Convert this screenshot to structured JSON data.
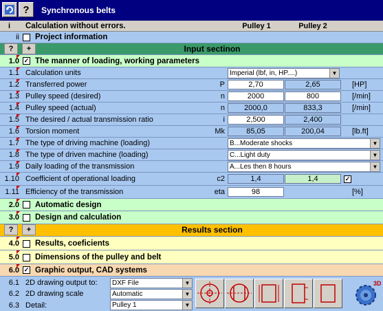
{
  "window": {
    "title": "Synchronous belts",
    "app_icon": "refresh-icon",
    "help_label": "?"
  },
  "header": {
    "i": "i",
    "status": "Calculation without errors.",
    "pulley1": "Pulley 1",
    "pulley2": "Pulley 2"
  },
  "project": {
    "idx": "ii",
    "label": "Project information"
  },
  "input_bar": {
    "q": "?",
    "plus": "+",
    "label": "Input sectinon"
  },
  "sections": {
    "s1": {
      "idx": "1.0",
      "label": "The manner of loading, working parameters",
      "checked": "✓"
    },
    "s2": {
      "idx": "2.0",
      "label": "Automatic design"
    },
    "s3": {
      "idx": "3.0",
      "label": "Design and calculation"
    },
    "s4": {
      "idx": "4.0",
      "label": "Results, coeficients"
    },
    "s5": {
      "idx": "5.0",
      "label": "Dimensions of the pulley and belt"
    },
    "s6": {
      "idx": "6.0",
      "label": "Graphic output, CAD systems",
      "checked": "✓"
    }
  },
  "results_bar": {
    "q": "?",
    "plus": "+",
    "label": "Results section"
  },
  "params": {
    "r1": {
      "idx": "1.1",
      "label": "Calculation units",
      "value": "Imperial (lbf, in, HP....)"
    },
    "r2": {
      "idx": "1.2",
      "label": "Transferred power",
      "sym": "P",
      "v1": "2,70",
      "v2": "2,65",
      "unit": "[HP]"
    },
    "r3": {
      "idx": "1.3",
      "label": "Pulley speed (desired)",
      "sym": "n",
      "v1": "2000",
      "v2": "800",
      "unit": "[/min]"
    },
    "r4": {
      "idx": "1.4",
      "label": "Pulley speed (actual)",
      "sym": "n",
      "v1": "2000,0",
      "v2": "833,3",
      "unit": "[/min]"
    },
    "r5": {
      "idx": "1.5",
      "label": "The desired / actual transmission ratio",
      "sym": "i",
      "v1": "2,500",
      "v2": "2,400"
    },
    "r6": {
      "idx": "1.6",
      "label": "Torsion moment",
      "sym": "Mk",
      "v1": "85,05",
      "v2": "200,04",
      "unit": "[lb.ft]"
    },
    "r7": {
      "idx": "1.7",
      "label": "The type of driving machine (loading)",
      "value": "B...Moderate shocks"
    },
    "r8": {
      "idx": "1.8",
      "label": "The type of driven machine (loading)",
      "value": "C...Light duty"
    },
    "r9": {
      "idx": "1.9",
      "label": "Daily loading of the transmission",
      "value": "A...Les then 8 hours"
    },
    "r10": {
      "idx": "1.10",
      "label": "Coefficient of operational loading",
      "sym": "c2",
      "v1": "1,4",
      "v2": "1,4",
      "checked": "✓"
    },
    "r11": {
      "idx": "1.11",
      "label": "Efficiency of the transmission",
      "sym": "eta",
      "v1": "98",
      "unit": "[%]"
    }
  },
  "graphics": {
    "g1": {
      "idx": "6.1",
      "label": "2D drawing output to:",
      "value": "DXF File"
    },
    "g2": {
      "idx": "6.2",
      "label": "2D drawing scale",
      "value": "Automatic"
    },
    "g3": {
      "idx": "6.3",
      "label": "Detail:",
      "value": "Pulley 1"
    }
  },
  "toolbar_icons": [
    "pulley-front-view-icon",
    "pulley-side-view-icon",
    "belt-front-icon",
    "belt-side-icon",
    "rectangle-icon",
    "gear-3d-icon"
  ],
  "colors": {
    "title_bg": "#000080",
    "section_green": "#c8ffc8",
    "section_yellow": "#ffffc0",
    "section_peach": "#f8d8b0",
    "input_bar": "#3a9a6a",
    "results_bar": "#ffc000"
  }
}
